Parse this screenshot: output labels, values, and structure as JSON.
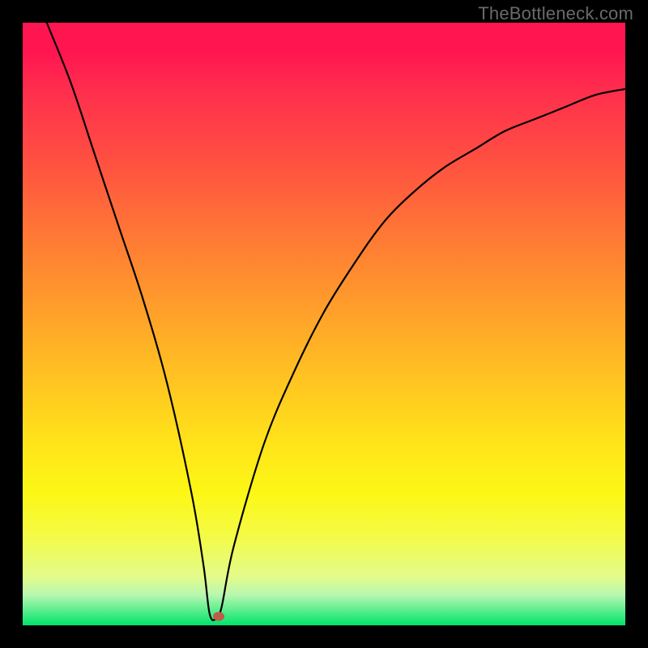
{
  "watermark": "TheBottleneck.com",
  "chart_data": {
    "type": "line",
    "title": "",
    "xlabel": "",
    "ylabel": "",
    "x_range": [
      0,
      100
    ],
    "y_range": [
      0,
      100
    ],
    "series": [
      {
        "name": "curve",
        "x": [
          0,
          4,
          8,
          12,
          16,
          20,
          24,
          28,
          30,
          31,
          32,
          33,
          35,
          40,
          45,
          50,
          55,
          60,
          65,
          70,
          75,
          80,
          85,
          90,
          95,
          100
        ],
        "y": [
          110,
          100,
          90,
          78,
          66,
          54,
          40,
          22,
          10,
          2,
          1,
          3,
          13,
          30,
          42,
          52,
          60,
          67,
          72,
          76,
          79,
          82,
          84,
          86,
          88,
          89
        ]
      }
    ],
    "marker": {
      "x": 32.5,
      "y": 1.5
    },
    "gradient_stops": [
      {
        "pos": 0,
        "color": "#ff1650"
      },
      {
        "pos": 22,
        "color": "#ff4d42"
      },
      {
        "pos": 46,
        "color": "#ff9a2c"
      },
      {
        "pos": 70,
        "color": "#ffe41a"
      },
      {
        "pos": 92,
        "color": "#e3fb8c"
      },
      {
        "pos": 100,
        "color": "#00e46c"
      }
    ]
  }
}
